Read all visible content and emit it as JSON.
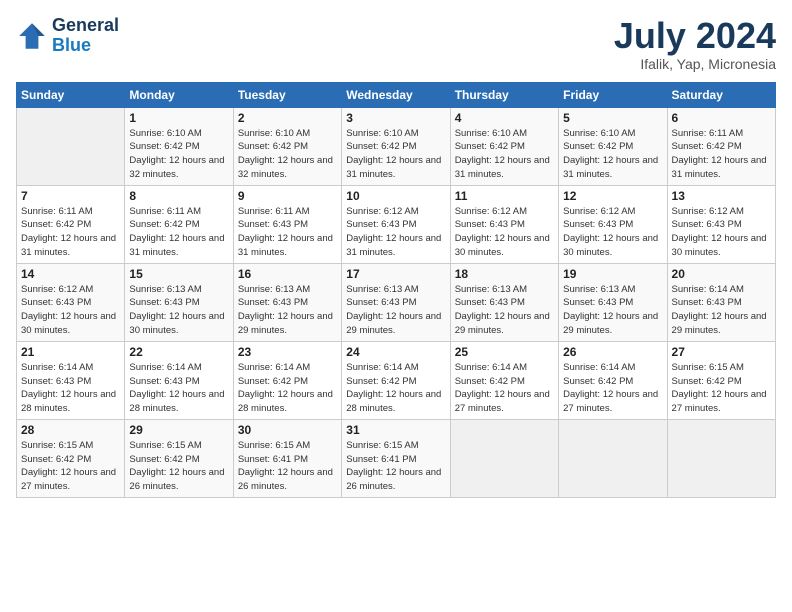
{
  "header": {
    "logo_general": "General",
    "logo_blue": "Blue",
    "title": "July 2024",
    "location": "Ifalik, Yap, Micronesia"
  },
  "columns": [
    "Sunday",
    "Monday",
    "Tuesday",
    "Wednesday",
    "Thursday",
    "Friday",
    "Saturday"
  ],
  "weeks": [
    [
      {
        "day": "",
        "empty": true
      },
      {
        "day": "1",
        "sunrise": "6:10 AM",
        "sunset": "6:42 PM",
        "daylight": "12 hours and 32 minutes."
      },
      {
        "day": "2",
        "sunrise": "6:10 AM",
        "sunset": "6:42 PM",
        "daylight": "12 hours and 32 minutes."
      },
      {
        "day": "3",
        "sunrise": "6:10 AM",
        "sunset": "6:42 PM",
        "daylight": "12 hours and 31 minutes."
      },
      {
        "day": "4",
        "sunrise": "6:10 AM",
        "sunset": "6:42 PM",
        "daylight": "12 hours and 31 minutes."
      },
      {
        "day": "5",
        "sunrise": "6:10 AM",
        "sunset": "6:42 PM",
        "daylight": "12 hours and 31 minutes."
      },
      {
        "day": "6",
        "sunrise": "6:11 AM",
        "sunset": "6:42 PM",
        "daylight": "12 hours and 31 minutes."
      }
    ],
    [
      {
        "day": "7",
        "sunrise": "6:11 AM",
        "sunset": "6:42 PM",
        "daylight": "12 hours and 31 minutes."
      },
      {
        "day": "8",
        "sunrise": "6:11 AM",
        "sunset": "6:42 PM",
        "daylight": "12 hours and 31 minutes."
      },
      {
        "day": "9",
        "sunrise": "6:11 AM",
        "sunset": "6:43 PM",
        "daylight": "12 hours and 31 minutes."
      },
      {
        "day": "10",
        "sunrise": "6:12 AM",
        "sunset": "6:43 PM",
        "daylight": "12 hours and 31 minutes."
      },
      {
        "day": "11",
        "sunrise": "6:12 AM",
        "sunset": "6:43 PM",
        "daylight": "12 hours and 30 minutes."
      },
      {
        "day": "12",
        "sunrise": "6:12 AM",
        "sunset": "6:43 PM",
        "daylight": "12 hours and 30 minutes."
      },
      {
        "day": "13",
        "sunrise": "6:12 AM",
        "sunset": "6:43 PM",
        "daylight": "12 hours and 30 minutes."
      }
    ],
    [
      {
        "day": "14",
        "sunrise": "6:12 AM",
        "sunset": "6:43 PM",
        "daylight": "12 hours and 30 minutes."
      },
      {
        "day": "15",
        "sunrise": "6:13 AM",
        "sunset": "6:43 PM",
        "daylight": "12 hours and 30 minutes."
      },
      {
        "day": "16",
        "sunrise": "6:13 AM",
        "sunset": "6:43 PM",
        "daylight": "12 hours and 29 minutes."
      },
      {
        "day": "17",
        "sunrise": "6:13 AM",
        "sunset": "6:43 PM",
        "daylight": "12 hours and 29 minutes."
      },
      {
        "day": "18",
        "sunrise": "6:13 AM",
        "sunset": "6:43 PM",
        "daylight": "12 hours and 29 minutes."
      },
      {
        "day": "19",
        "sunrise": "6:13 AM",
        "sunset": "6:43 PM",
        "daylight": "12 hours and 29 minutes."
      },
      {
        "day": "20",
        "sunrise": "6:14 AM",
        "sunset": "6:43 PM",
        "daylight": "12 hours and 29 minutes."
      }
    ],
    [
      {
        "day": "21",
        "sunrise": "6:14 AM",
        "sunset": "6:43 PM",
        "daylight": "12 hours and 28 minutes."
      },
      {
        "day": "22",
        "sunrise": "6:14 AM",
        "sunset": "6:43 PM",
        "daylight": "12 hours and 28 minutes."
      },
      {
        "day": "23",
        "sunrise": "6:14 AM",
        "sunset": "6:42 PM",
        "daylight": "12 hours and 28 minutes."
      },
      {
        "day": "24",
        "sunrise": "6:14 AM",
        "sunset": "6:42 PM",
        "daylight": "12 hours and 28 minutes."
      },
      {
        "day": "25",
        "sunrise": "6:14 AM",
        "sunset": "6:42 PM",
        "daylight": "12 hours and 27 minutes."
      },
      {
        "day": "26",
        "sunrise": "6:14 AM",
        "sunset": "6:42 PM",
        "daylight": "12 hours and 27 minutes."
      },
      {
        "day": "27",
        "sunrise": "6:15 AM",
        "sunset": "6:42 PM",
        "daylight": "12 hours and 27 minutes."
      }
    ],
    [
      {
        "day": "28",
        "sunrise": "6:15 AM",
        "sunset": "6:42 PM",
        "daylight": "12 hours and 27 minutes."
      },
      {
        "day": "29",
        "sunrise": "6:15 AM",
        "sunset": "6:42 PM",
        "daylight": "12 hours and 26 minutes."
      },
      {
        "day": "30",
        "sunrise": "6:15 AM",
        "sunset": "6:41 PM",
        "daylight": "12 hours and 26 minutes."
      },
      {
        "day": "31",
        "sunrise": "6:15 AM",
        "sunset": "6:41 PM",
        "daylight": "12 hours and 26 minutes."
      },
      {
        "day": "",
        "empty": true
      },
      {
        "day": "",
        "empty": true
      },
      {
        "day": "",
        "empty": true
      }
    ]
  ],
  "labels": {
    "sunrise_prefix": "Sunrise: ",
    "sunset_prefix": "Sunset: ",
    "daylight_prefix": "Daylight: "
  }
}
